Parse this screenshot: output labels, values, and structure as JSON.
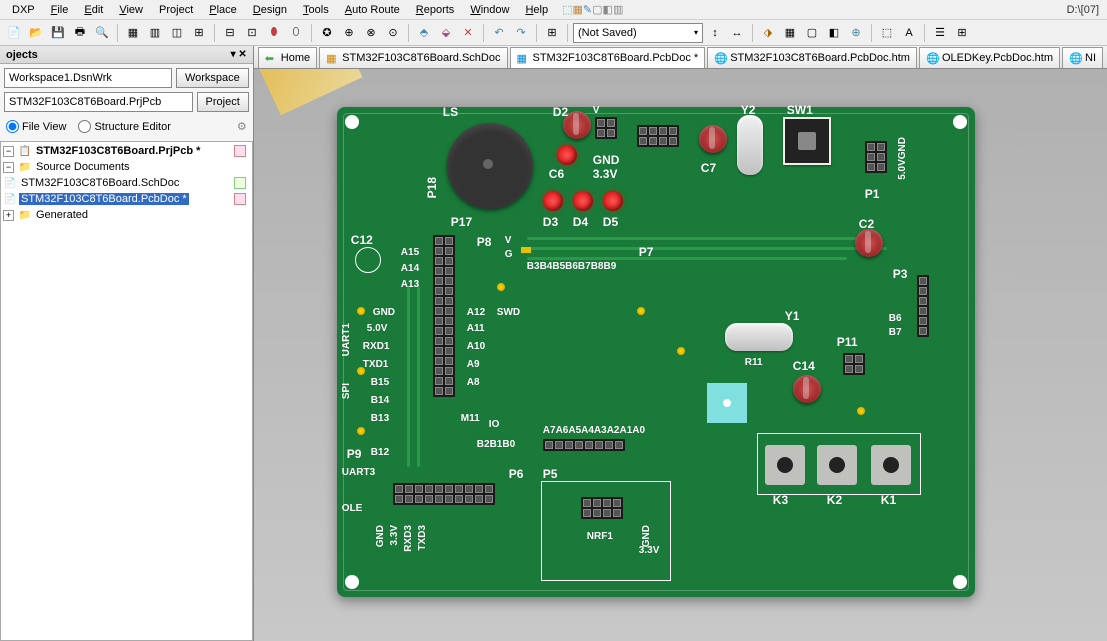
{
  "menu": [
    "DXP",
    "File",
    "Edit",
    "View",
    "Project",
    "Place",
    "Design",
    "Tools",
    "Auto Route",
    "Reports",
    "Window",
    "Help"
  ],
  "path": "D:\\[07]",
  "toolbar": {
    "saveState": "(Not Saved)"
  },
  "panel": {
    "title": "ojects",
    "workspace": "Workspace1.DsnWrk",
    "workspaceBtn": "Workspace",
    "project": "STM32F103C8T6Board.PrjPcb",
    "projectBtn": "Project",
    "radios": {
      "fileView": "File View",
      "structure": "Structure Editor"
    },
    "tree": {
      "root": "STM32F103C8T6Board.PrjPcb *",
      "src": "Source Documents",
      "sch": "STM32F103C8T6Board.SchDoc",
      "pcb": "STM32F103C8T6Board.PcbDoc *",
      "gen": "Generated"
    }
  },
  "tabs": [
    {
      "label": "Home",
      "ico": "home"
    },
    {
      "label": "STM32F103C8T6Board.SchDoc",
      "ico": "sch"
    },
    {
      "label": "STM32F103C8T6Board.PcbDoc *",
      "ico": "pcb",
      "active": true
    },
    {
      "label": "STM32F103C8T6Board.PcbDoc.htm",
      "ico": "htm"
    },
    {
      "label": "OLEDKey.PcbDoc.htm",
      "ico": "htm"
    },
    {
      "label": "NI",
      "ico": "htm"
    }
  ],
  "silk": {
    "LS": "LS",
    "D2": "D2",
    "Y2": "Y2",
    "SW1": "SW1",
    "C6": "C6",
    "GND": "GND",
    "V33": "3.3V",
    "C7": "C7",
    "P18": "P18",
    "P1": "P1",
    "V5GND": "5.0VGND",
    "D3": "D3",
    "D4": "D4",
    "D5": "D5",
    "C2": "C2",
    "C12": "C12",
    "P17": "P17",
    "P8": "P8",
    "V": "V",
    "G": "G",
    "A15": "A15",
    "A14": "A14",
    "A13": "A13",
    "P7": "P7",
    "B3B4B5B6B7B8B9": "B3B4B5B6B7B8B9",
    "P3": "P3",
    "GND2": "GND",
    "A12": "A12",
    "SWD": "SWD",
    "V50": "5.0V",
    "A11": "A11",
    "UART1": "UART1",
    "RXD1": "RXD1",
    "A10": "A10",
    "TXD1": "TXD1",
    "A9": "A9",
    "SPI": "SPI",
    "B15": "B15",
    "A8": "A8",
    "B14": "B14",
    "Y1": "Y1",
    "R11": "R11",
    "B13": "B13",
    "P11text": "P11",
    "B6": "B6",
    "B7": "B7",
    "P9": "P9",
    "B12": "B12",
    "M11": "M11",
    "IO": "IO",
    "B2B1B0": "B2B1B0",
    "A7A6A5A4A3A2A1A0": "A7A6A5A4A3A2A1A0",
    "C14": "C14",
    "UART3": "UART3",
    "P6": "P6",
    "P5": "P5",
    "OLE": "OLE",
    "NRF1": "NRF1",
    "K1": "K1",
    "K2": "K2",
    "K3": "K3",
    "GND3": "GND",
    "V33b": "3.3V",
    "RXD3": "RXD3",
    "TXD3": "TXD3",
    "GND4": "GND",
    "V33c": "3.3V"
  }
}
